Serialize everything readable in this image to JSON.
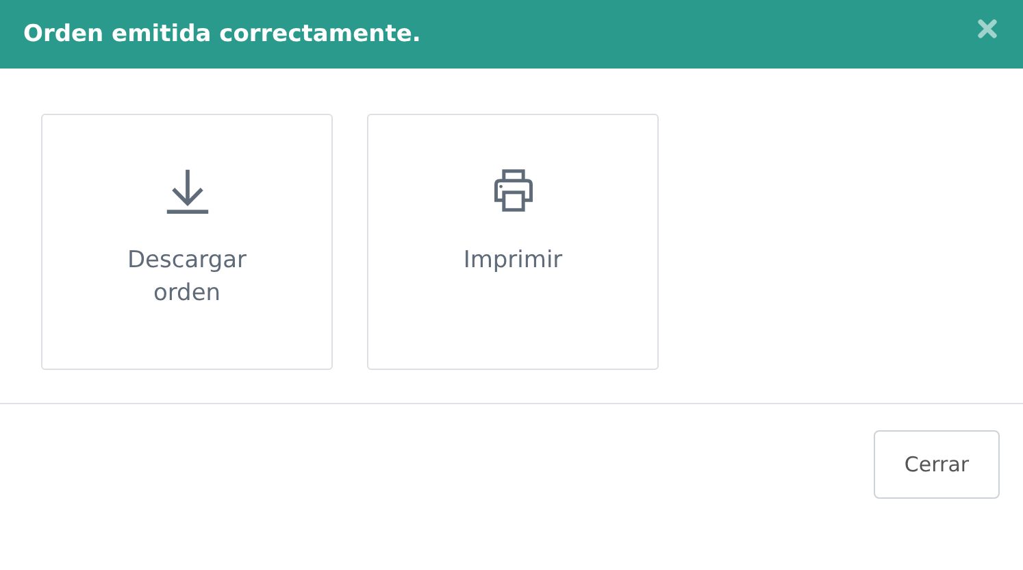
{
  "header": {
    "title": "Orden emitida correctamente."
  },
  "actions": [
    {
      "kind": "download",
      "label": "Descargar orden"
    },
    {
      "kind": "print",
      "label": "Imprimir"
    }
  ],
  "footer": {
    "buttons": [
      "Cerrar"
    ]
  }
}
